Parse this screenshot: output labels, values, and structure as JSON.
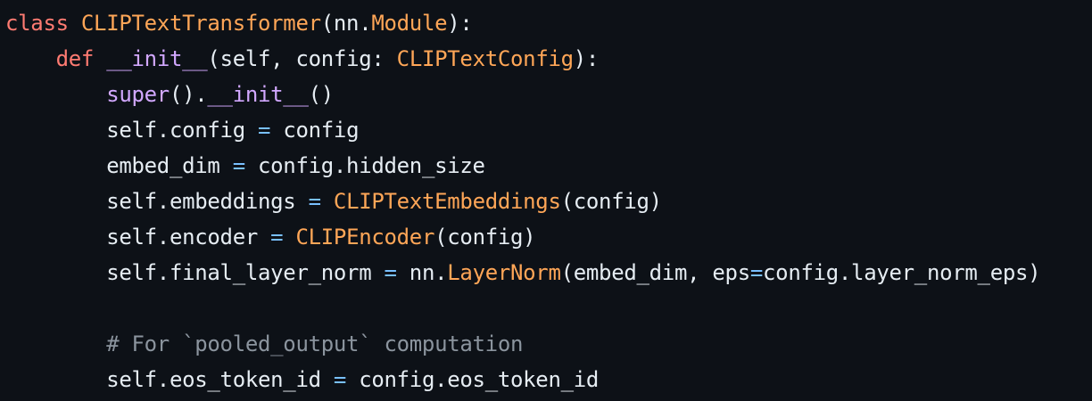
{
  "colors": {
    "background": "#0d1117",
    "default_text": "#e6edf3",
    "keyword": "#ff7b72",
    "class_name": "#ffa657",
    "builtin_function": "#d2a8ff",
    "operator": "#79c0ff",
    "comment": "#8b949e"
  },
  "code": {
    "language": "python",
    "lines": [
      {
        "indent": "",
        "tokens": [
          {
            "text": "class",
            "kind": "kw"
          },
          {
            "text": " ",
            "kind": "ws"
          },
          {
            "text": "CLIPTextTransformer",
            "kind": "cls"
          },
          {
            "text": "(nn.",
            "kind": "id"
          },
          {
            "text": "Module",
            "kind": "cls"
          },
          {
            "text": "):",
            "kind": "id"
          }
        ]
      },
      {
        "indent": "    ",
        "tokens": [
          {
            "text": "def",
            "kind": "kw"
          },
          {
            "text": " ",
            "kind": "ws"
          },
          {
            "text": "__init__",
            "kind": "fn"
          },
          {
            "text": "(self, config: ",
            "kind": "id"
          },
          {
            "text": "CLIPTextConfig",
            "kind": "cls"
          },
          {
            "text": "):",
            "kind": "id"
          }
        ]
      },
      {
        "indent": "        ",
        "tokens": [
          {
            "text": "super",
            "kind": "fn"
          },
          {
            "text": "().",
            "kind": "id"
          },
          {
            "text": "__init__",
            "kind": "fn"
          },
          {
            "text": "()",
            "kind": "id"
          }
        ]
      },
      {
        "indent": "        ",
        "tokens": [
          {
            "text": "self.config",
            "kind": "id"
          },
          {
            "text": " ",
            "kind": "ws"
          },
          {
            "text": "=",
            "kind": "op"
          },
          {
            "text": " config",
            "kind": "id"
          }
        ]
      },
      {
        "indent": "        ",
        "tokens": [
          {
            "text": "embed_dim",
            "kind": "id"
          },
          {
            "text": " ",
            "kind": "ws"
          },
          {
            "text": "=",
            "kind": "op"
          },
          {
            "text": " config.hidden_size",
            "kind": "id"
          }
        ]
      },
      {
        "indent": "        ",
        "tokens": [
          {
            "text": "self.embeddings",
            "kind": "id"
          },
          {
            "text": " ",
            "kind": "ws"
          },
          {
            "text": "=",
            "kind": "op"
          },
          {
            "text": " ",
            "kind": "ws"
          },
          {
            "text": "CLIPTextEmbeddings",
            "kind": "cls"
          },
          {
            "text": "(config)",
            "kind": "id"
          }
        ]
      },
      {
        "indent": "        ",
        "tokens": [
          {
            "text": "self.encoder",
            "kind": "id"
          },
          {
            "text": " ",
            "kind": "ws"
          },
          {
            "text": "=",
            "kind": "op"
          },
          {
            "text": " ",
            "kind": "ws"
          },
          {
            "text": "CLIPEncoder",
            "kind": "cls"
          },
          {
            "text": "(config)",
            "kind": "id"
          }
        ]
      },
      {
        "indent": "        ",
        "tokens": [
          {
            "text": "self.final_layer_norm",
            "kind": "id"
          },
          {
            "text": " ",
            "kind": "ws"
          },
          {
            "text": "=",
            "kind": "op"
          },
          {
            "text": " nn.",
            "kind": "id"
          },
          {
            "text": "LayerNorm",
            "kind": "cls"
          },
          {
            "text": "(embed_dim, eps",
            "kind": "id"
          },
          {
            "text": "=",
            "kind": "op"
          },
          {
            "text": "config.layer_norm_eps)",
            "kind": "id"
          }
        ]
      },
      {
        "indent": "",
        "tokens": []
      },
      {
        "indent": "        ",
        "tokens": [
          {
            "text": "# For `pooled_output` computation",
            "kind": "cm"
          }
        ]
      },
      {
        "indent": "        ",
        "tokens": [
          {
            "text": "self.eos_token_id",
            "kind": "id"
          },
          {
            "text": " ",
            "kind": "ws"
          },
          {
            "text": "=",
            "kind": "op"
          },
          {
            "text": " config.eos_token_id",
            "kind": "id"
          }
        ]
      }
    ]
  }
}
